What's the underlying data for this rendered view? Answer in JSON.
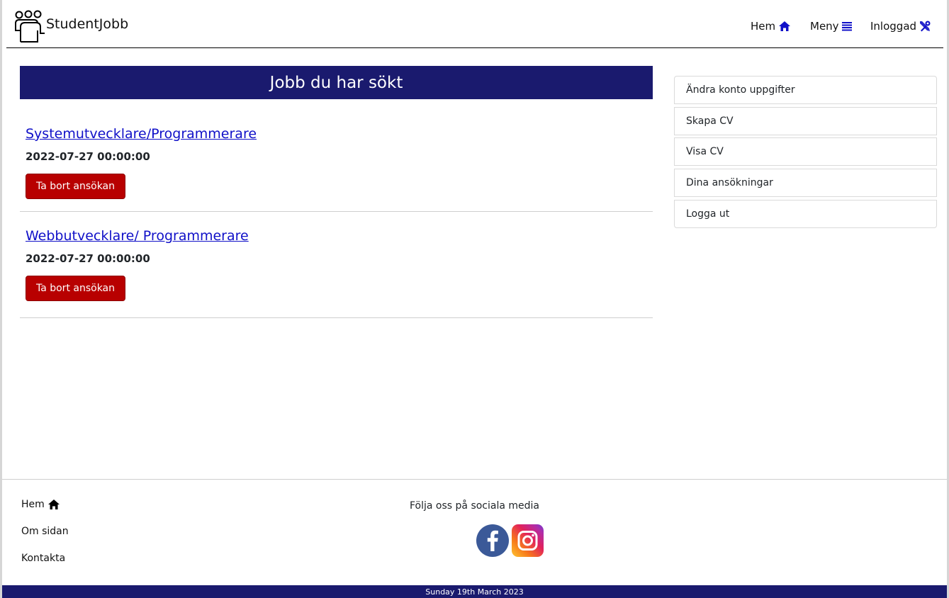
{
  "header": {
    "brand": "StudentJobb",
    "logo_icon": "people-group-icon",
    "nav": [
      {
        "label": "Hem",
        "icon": "home-icon"
      },
      {
        "label": "Meny",
        "icon": "list-icon"
      },
      {
        "label": "Inloggad",
        "icon": "tools-icon"
      }
    ],
    "accent_color": "#1010c8"
  },
  "main": {
    "title": "Jobb du har sökt",
    "title_bg": "#1a1a6e",
    "jobs": [
      {
        "title": "Systemutvecklare/Programmerare",
        "date": "2022-07-27 00:00:00",
        "button": "Ta bort ansökan"
      },
      {
        "title": "Webbutvecklare/ Programmerare",
        "date": "2022-07-27 00:00:00",
        "button": "Ta bort ansökan"
      }
    ],
    "button_color": "#b80000"
  },
  "sidebar": {
    "items": [
      {
        "label": "Ändra konto uppgifter"
      },
      {
        "label": "Skapa CV"
      },
      {
        "label": "Visa CV"
      },
      {
        "label": "Dina ansökningar"
      },
      {
        "label": "Logga ut"
      }
    ]
  },
  "footer": {
    "links": [
      {
        "label": "Hem",
        "icon": "home-icon"
      },
      {
        "label": "Om sidan"
      },
      {
        "label": "Kontakta"
      }
    ],
    "social_label": "Följa oss på sociala media",
    "social": [
      {
        "icon": "facebook-icon"
      },
      {
        "icon": "instagram-icon"
      }
    ],
    "date": "Sunday 19th March 2023"
  }
}
